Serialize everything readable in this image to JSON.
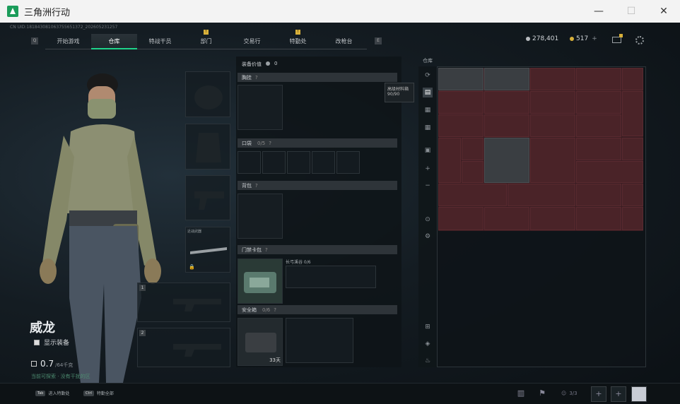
{
  "window": {
    "title": "三角洲行动",
    "minimize": "—",
    "maximize": "☐",
    "close": "✕"
  },
  "uid": "CN UID:181843081063755651372_202605231257",
  "nav": {
    "left_key": "Q",
    "right_key": "E",
    "tabs": [
      {
        "label": "开始游戏"
      },
      {
        "label": "仓库",
        "active": true
      },
      {
        "label": "特战干员"
      },
      {
        "label": "部门",
        "badge": "!"
      },
      {
        "label": "交易行"
      },
      {
        "label": "特勤处",
        "badge": "!"
      },
      {
        "label": "改枪台"
      }
    ]
  },
  "currency": {
    "money": "278,401",
    "coupons": "517",
    "plus": "+"
  },
  "character": {
    "name": "威龙",
    "show_equipment": "显示装备",
    "weight_value": "0.7",
    "weight_max": "/64千克",
    "hint": "当前可探索 · 没有干扰的区"
  },
  "equipment_panel": {
    "value_label": "装备价值",
    "value": "0",
    "sections": {
      "chest_rig": "胸挂",
      "pockets": "口袋",
      "pockets_count": "0/5",
      "backpack": "背包",
      "key_case": "门禁卡包",
      "key_case_count": "长弓溪谷 0/6",
      "secure": "安全箱",
      "secure_count": "0/6",
      "secure_days": "33天"
    },
    "weapon_slot_label": "近战武器",
    "slot_nums": [
      "1",
      "2"
    ]
  },
  "tooltip": {
    "line1": "高级材料箱",
    "line2": "90/90"
  },
  "storage": {
    "label": "仓库"
  },
  "bottom": {
    "hint1_key": "Tab",
    "hint1_text": "进入特勤处",
    "hint2_key": "Ctrl",
    "hint2_text": "特勤全部",
    "team_label": "3/3"
  },
  "colors": {
    "accent": "#1fd38a",
    "badge": "#d8b03a",
    "rare_item": "#4a2328"
  }
}
